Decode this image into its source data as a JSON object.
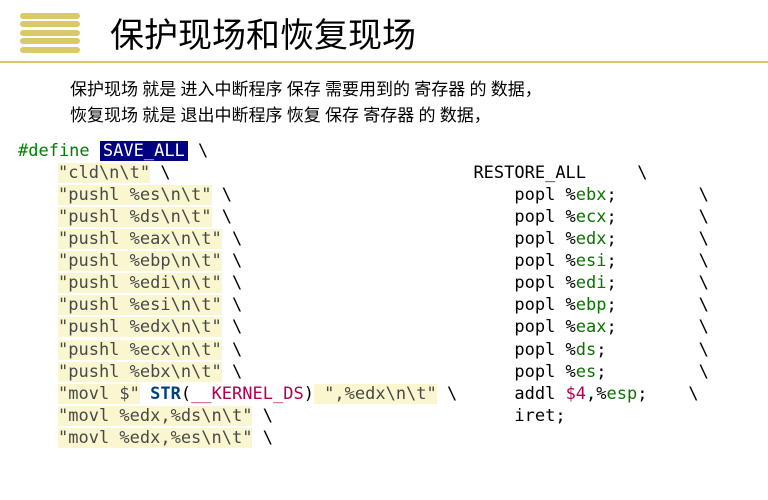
{
  "header": {
    "title": "保护现场和恢复现场"
  },
  "desc": {
    "line1": "保护现场 就是 进入中断程序 保存 需要用到的 寄存器 的 数据，",
    "line2": "恢复现场 就是 退出中断程序 恢复 保存 寄存器 的 数据，"
  },
  "left": {
    "define": "#define",
    "macro": "SAVE_ALL",
    "bs": " \\",
    "l1": "\"cld\\n\\t\"",
    "l2": "\"pushl %es\\n\\t\"",
    "l3": "\"pushl %ds\\n\\t\"",
    "l4": "\"pushl %eax\\n\\t\"",
    "l5": "\"pushl %ebp\\n\\t\"",
    "l6": "\"pushl %edi\\n\\t\"",
    "l7": "\"pushl %esi\\n\\t\"",
    "l8": "\"pushl %edx\\n\\t\"",
    "l9": "\"pushl %ecx\\n\\t\"",
    "l10": "\"pushl %ebx\\n\\t\"",
    "l11a": "\"movl $\"",
    "l11str": " STR",
    "l11p1": "(",
    "l11kds": "__KERNEL_DS",
    "l11p2": ")",
    "l11b": " \",%edx\\n\\t\"",
    "l12": "\"movl %edx,%ds\\n\\t\"",
    "l13": "\"movl %edx,%es\\n\\t\""
  },
  "right": {
    "label": "RESTORE_ALL     \\",
    "p1a": "    popl %",
    "p1b": "ebx",
    "p1c": ";        \\",
    "p2a": "    popl %",
    "p2b": "ecx",
    "p2c": ";        \\",
    "p3a": "    popl %",
    "p3b": "edx",
    "p3c": ";        \\",
    "p4a": "    popl %",
    "p4b": "esi",
    "p4c": ";        \\",
    "p5a": "    popl %",
    "p5b": "edi",
    "p5c": ";        \\",
    "p6a": "    popl %",
    "p6b": "ebp",
    "p6c": ";        \\",
    "p7a": "    popl %",
    "p7b": "eax",
    "p7c": ";        \\",
    "p8a": "    popl %",
    "p8b": "ds",
    "p8c": ";         \\",
    "p9a": "    popl %",
    "p9b": "es",
    "p9c": ";         \\",
    "p10a": "    addl ",
    "p10b": "$4",
    "p10c": ",%",
    "p10d": "esp",
    "p10e": ";    \\",
    "p11": "    iret;"
  }
}
